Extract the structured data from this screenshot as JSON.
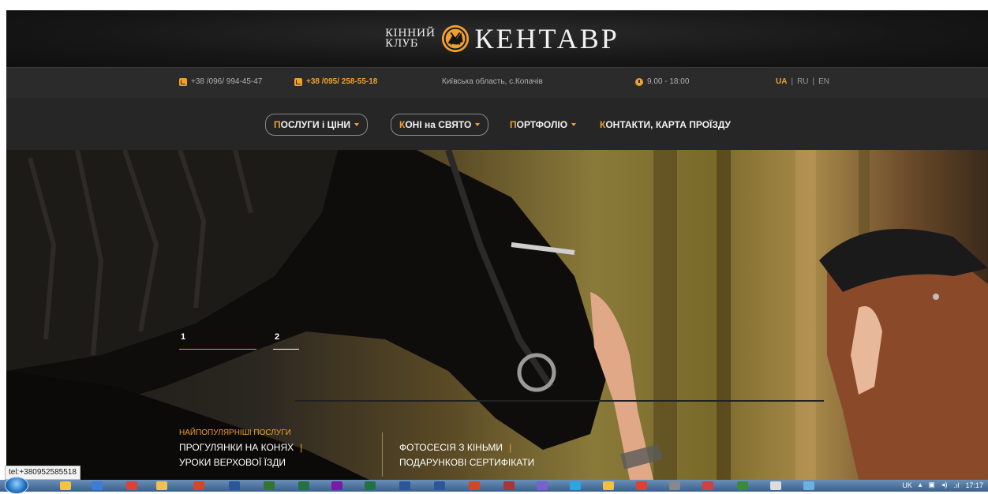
{
  "header": {
    "logo_small_line1": "КІННИЙ",
    "logo_small_line2": "КЛУБ",
    "logo_big": "КЕНТАВР"
  },
  "contacts": {
    "phone1": "+38 /096/ 994-45-47",
    "phone2": "+38 /095/ 258-55-18",
    "address": "Київська область, с.Копачів",
    "hours": "9.00 - 18:00",
    "lang_ua": "UA",
    "lang_sep1": "|",
    "lang_ru": "RU",
    "lang_sep2": "|",
    "lang_en": "EN"
  },
  "nav": {
    "item1_first": "П",
    "item1_rest": "ОСЛУГИ і ЦІНИ",
    "item2_first": "К",
    "item2_rest": "ОНІ на СВЯТО",
    "item3_first": "П",
    "item3_rest": "ОРТФОЛІО",
    "item4_first": "К",
    "item4_rest": "ОНТАКТИ, КАРТА ПРОЇЗДУ"
  },
  "slider": {
    "slide1": "1",
    "slide2": "2"
  },
  "services": {
    "title": "НАЙПОПУЛЯРНІШІ ПОСЛУГИ",
    "s1": "ПРОГУЛЯНКИ НА КОНЯХ",
    "s2": "УРОКИ ВЕРХОВОЇ ЇЗДИ",
    "s3": "ФОТОСЕСІЯ З КІНЬМИ",
    "s4": "ПОДАРУНКОВІ СЕРТИФІКАТИ",
    "sep": "|"
  },
  "status": {
    "url": "tel:+380952585518"
  },
  "taskbar": {
    "lang": "UK",
    "time": "17:17"
  },
  "colors": {
    "accent": "#f0a030",
    "header_bg": "#161616",
    "nav_bg": "#262626"
  }
}
